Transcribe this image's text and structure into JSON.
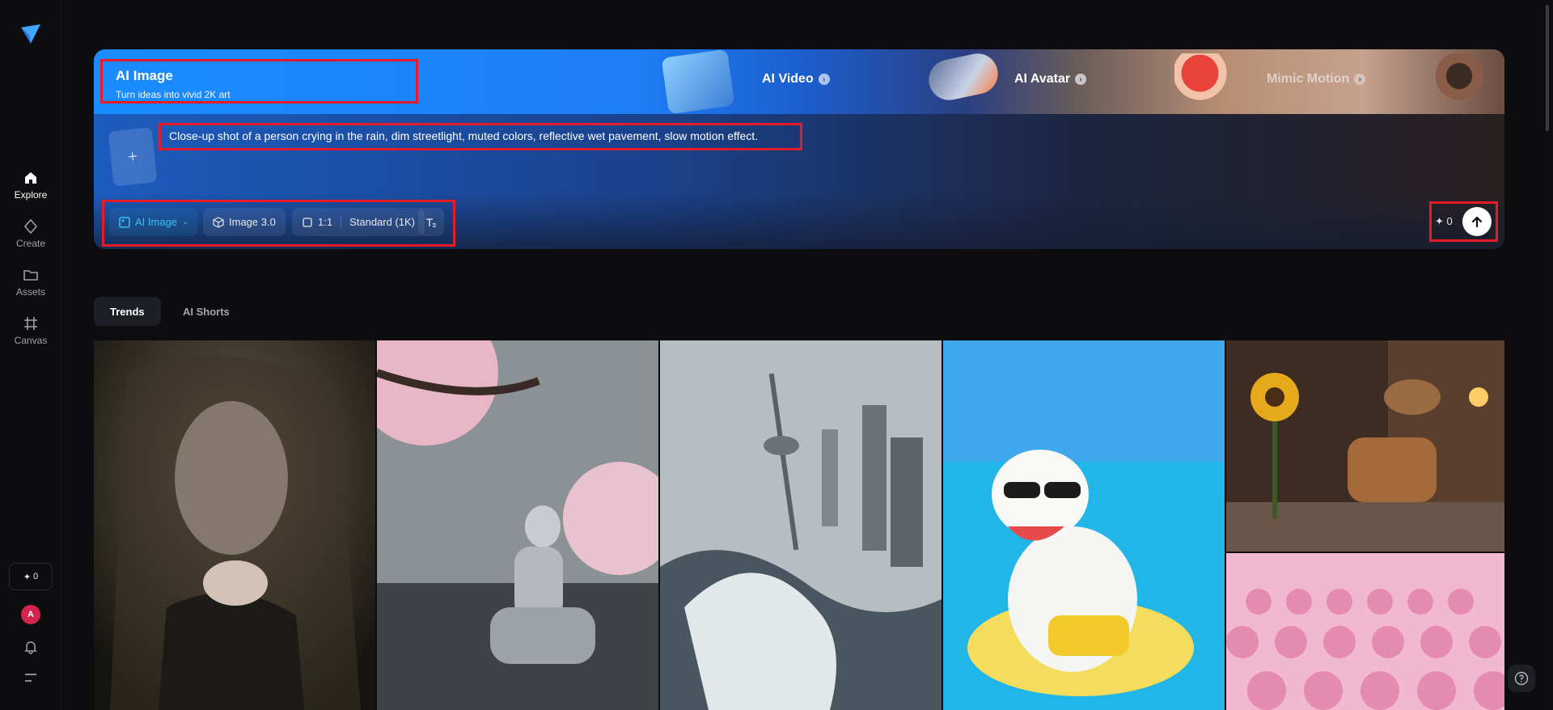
{
  "nav": {
    "items": [
      {
        "label": "Explore",
        "icon": "home-icon"
      },
      {
        "label": "Create",
        "icon": "diamond-icon"
      },
      {
        "label": "Assets",
        "icon": "folder-icon"
      },
      {
        "label": "Canvas",
        "icon": "canvas-icon"
      }
    ],
    "credits": "0",
    "avatar_initial": "A"
  },
  "banner": {
    "active_tab": {
      "title": "AI Image",
      "subtitle": "Turn ideas into vivid 2K art"
    },
    "tabs": [
      {
        "label": "AI Video"
      },
      {
        "label": "AI Avatar"
      },
      {
        "label": "Mimic Motion"
      }
    ]
  },
  "prompt": {
    "text": "Close-up shot of a person crying in the rain, dim streetlight, muted colors, reflective wet pavement, slow motion effect."
  },
  "toolbar": {
    "mode": "AI Image",
    "model": "Image 3.0",
    "ratio": "1:1",
    "quality": "Standard (1K)",
    "credits": "0"
  },
  "content_tabs": [
    {
      "label": "Trends"
    },
    {
      "label": "AI Shorts"
    }
  ],
  "gallery": [
    {
      "name": "veiled-portrait"
    },
    {
      "name": "praying-robot-cherry-blossoms"
    },
    {
      "name": "tsunami-city-tower"
    },
    {
      "name": "cat-pool-float-watermelon"
    },
    {
      "name": "steampunk-bird-teapot"
    },
    {
      "name": "pink-robot-crowd"
    }
  ],
  "colors": {
    "accent": "#36c3f0",
    "highlight": "#e51b2a",
    "background": "#0d0d10"
  }
}
